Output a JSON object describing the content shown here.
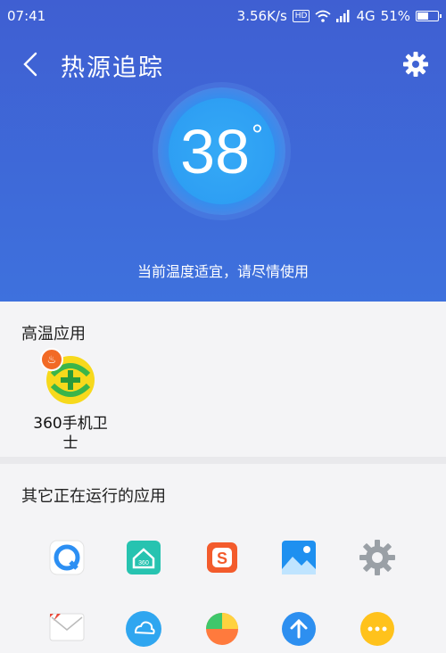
{
  "status_bar": {
    "time": "07:41",
    "network_speed": "3.56K/s",
    "hd_label": "HD",
    "network_type": "4G",
    "battery_percent": "51%",
    "battery_level": 0.51
  },
  "header": {
    "title": "热源追踪",
    "back_icon": "chevron-left-icon",
    "settings_icon": "gear-icon",
    "temperature_value": "38",
    "temperature_unit": "°",
    "message": "当前温度适宜，请尽情使用",
    "colors": {
      "gradient_top": "#3f5fd2",
      "gradient_bottom": "#3e71dd",
      "ring": "#2f8ff0"
    }
  },
  "hot_apps": {
    "title": "高温应用",
    "items": [
      {
        "label": "360手机卫\n士",
        "icon": "360-security-icon",
        "badge_icon": "fire-icon"
      }
    ]
  },
  "other_apps": {
    "title": "其它正在运行的应用",
    "icons": [
      "browser-q-icon",
      "360-home-icon",
      "sogou-input-icon",
      "gallery-icon",
      "settings-gear-icon",
      "mail-icon",
      "cloud-icon",
      "game-center-icon",
      "upload-icon",
      "more-icon"
    ]
  }
}
